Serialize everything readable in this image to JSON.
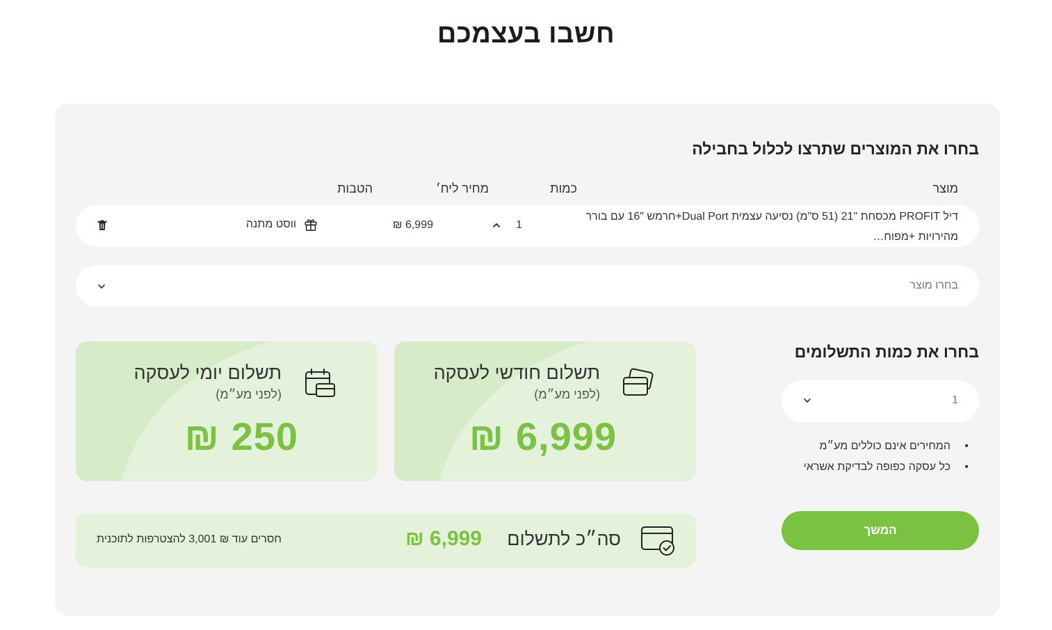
{
  "page": {
    "title": "חשבו בעצמכם"
  },
  "products": {
    "section_title": "בחרו את המוצרים שתרצו לכלול בחבילה",
    "columns": {
      "product": "מוצר",
      "quantity": "כמות",
      "list_price": "מחיר ליח׳",
      "benefits": "הטבות"
    },
    "row": {
      "name": "דיל PROFIT מכסחת \"21 (51 ס\"מ) נסיעה עצמית Dual Port+חרמש \"16 עם בורר מהירויות +מפוח…",
      "quantity": "1",
      "price": "6,999 ₪",
      "benefit": "ווסט מתנה"
    },
    "select_placeholder": "בחרו מוצר"
  },
  "payments": {
    "title": "בחרו את כמות התשלומים",
    "installments_value": "1",
    "notes": [
      "המחירים אינם כוללים מע״מ",
      "כל עסקה כפופה לבדיקת אשראי"
    ],
    "continue_label": "המשך"
  },
  "cards": {
    "monthly": {
      "title": "תשלום חודשי לעסקה",
      "subtitle": "(לפני מע״מ)",
      "amount": "6,999 ₪"
    },
    "daily": {
      "title": "תשלום יומי לעסקה",
      "subtitle": "(לפני מע״מ)",
      "amount": "250 ₪"
    }
  },
  "total": {
    "label": "סה״כ לתשלום",
    "amount": "6,999 ₪",
    "missing_text": "חסרים עוד ₪ 3,001 להצטרפות לתוכנית"
  },
  "colors": {
    "accent": "#7bc142",
    "card_bg": "#e4f1db",
    "panel_bg": "#f4f4f4"
  },
  "icons": [
    "chevron-up-icon",
    "gift-icon",
    "trash-icon",
    "chevron-down-icon",
    "credit-cards-icon",
    "calendar-card-icon",
    "card-check-icon"
  ]
}
